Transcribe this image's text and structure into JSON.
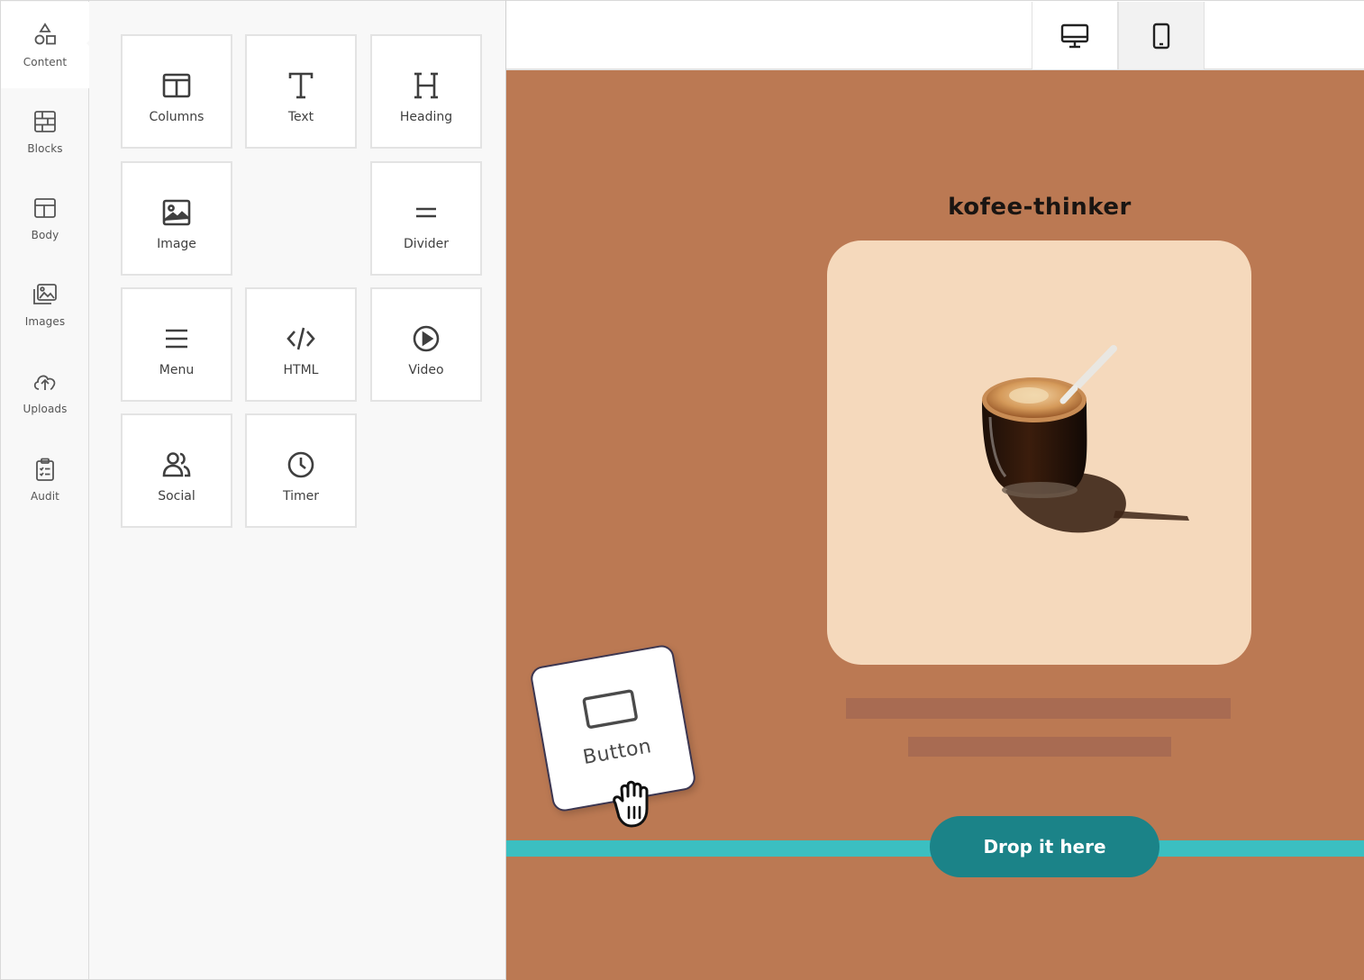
{
  "sidebar": {
    "items": [
      {
        "label": "Content",
        "icon": "shapes-icon",
        "active": true
      },
      {
        "label": "Blocks",
        "icon": "blocks-icon",
        "active": false
      },
      {
        "label": "Body",
        "icon": "body-layout-icon",
        "active": false
      },
      {
        "label": "Images",
        "icon": "images-icon",
        "active": false
      },
      {
        "label": "Uploads",
        "icon": "cloud-upload-icon",
        "active": false
      },
      {
        "label": "Audit",
        "icon": "clipboard-check-icon",
        "active": false
      }
    ]
  },
  "tools": [
    {
      "label": "Columns",
      "icon": "columns-icon"
    },
    {
      "label": "Text",
      "icon": "text-t-icon"
    },
    {
      "label": "Heading",
      "icon": "heading-h-icon"
    },
    {
      "label": "Image",
      "icon": "image-icon"
    },
    {
      "label": "Divider",
      "icon": "divider-icon"
    },
    {
      "label": "Menu",
      "icon": "menu-icon"
    },
    {
      "label": "HTML",
      "icon": "code-icon"
    },
    {
      "label": "Video",
      "icon": "play-circle-icon"
    },
    {
      "label": "Social",
      "icon": "users-icon"
    },
    {
      "label": "Timer",
      "icon": "clock-icon"
    }
  ],
  "toolbar": {
    "devices": [
      {
        "name": "desktop",
        "icon": "desktop-icon"
      },
      {
        "name": "mobile",
        "icon": "mobile-icon",
        "selected": true
      }
    ]
  },
  "canvas": {
    "brand_name": "kofee-thinker",
    "drop_target_label": "Drop it here",
    "colors": {
      "background": "#bb7953",
      "card": "#f5d9bc",
      "drop_line": "#3bbfc1",
      "drop_pill": "#1b8388"
    }
  },
  "drag": {
    "label": "Button",
    "icon": "button-rect-icon",
    "cursor": "grab-hand-cursor-icon"
  }
}
